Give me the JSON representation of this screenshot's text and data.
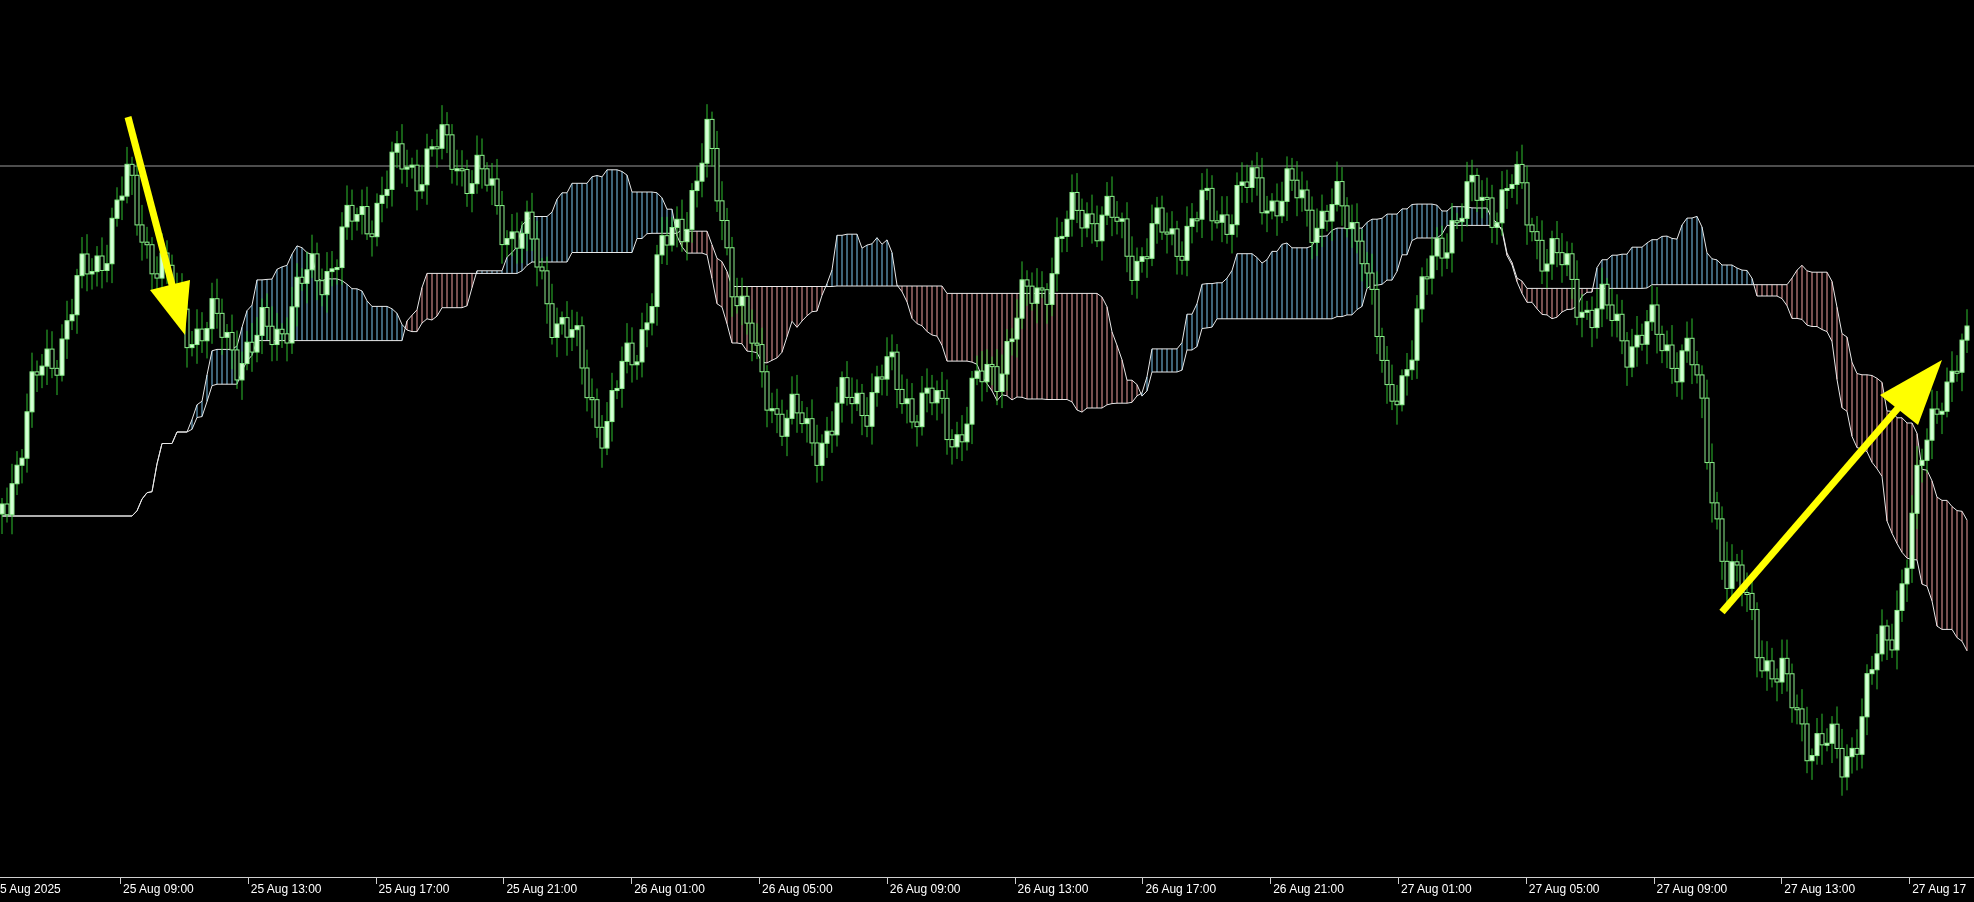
{
  "chart": {
    "x_axis_labels": [
      "5 Aug 2025",
      "25 Aug 09:00",
      "25 Aug 13:00",
      "25 Aug 17:00",
      "25 Aug 21:00",
      "26 Aug 01:00",
      "26 Aug 05:00",
      "26 Aug 09:00",
      "26 Aug 13:00",
      "26 Aug 17:00",
      "26 Aug 21:00",
      "27 Aug 01:00",
      "27 Aug 05:00",
      "27 Aug 09:00",
      "27 Aug 13:00",
      "27 Aug 17"
    ]
  }
}
